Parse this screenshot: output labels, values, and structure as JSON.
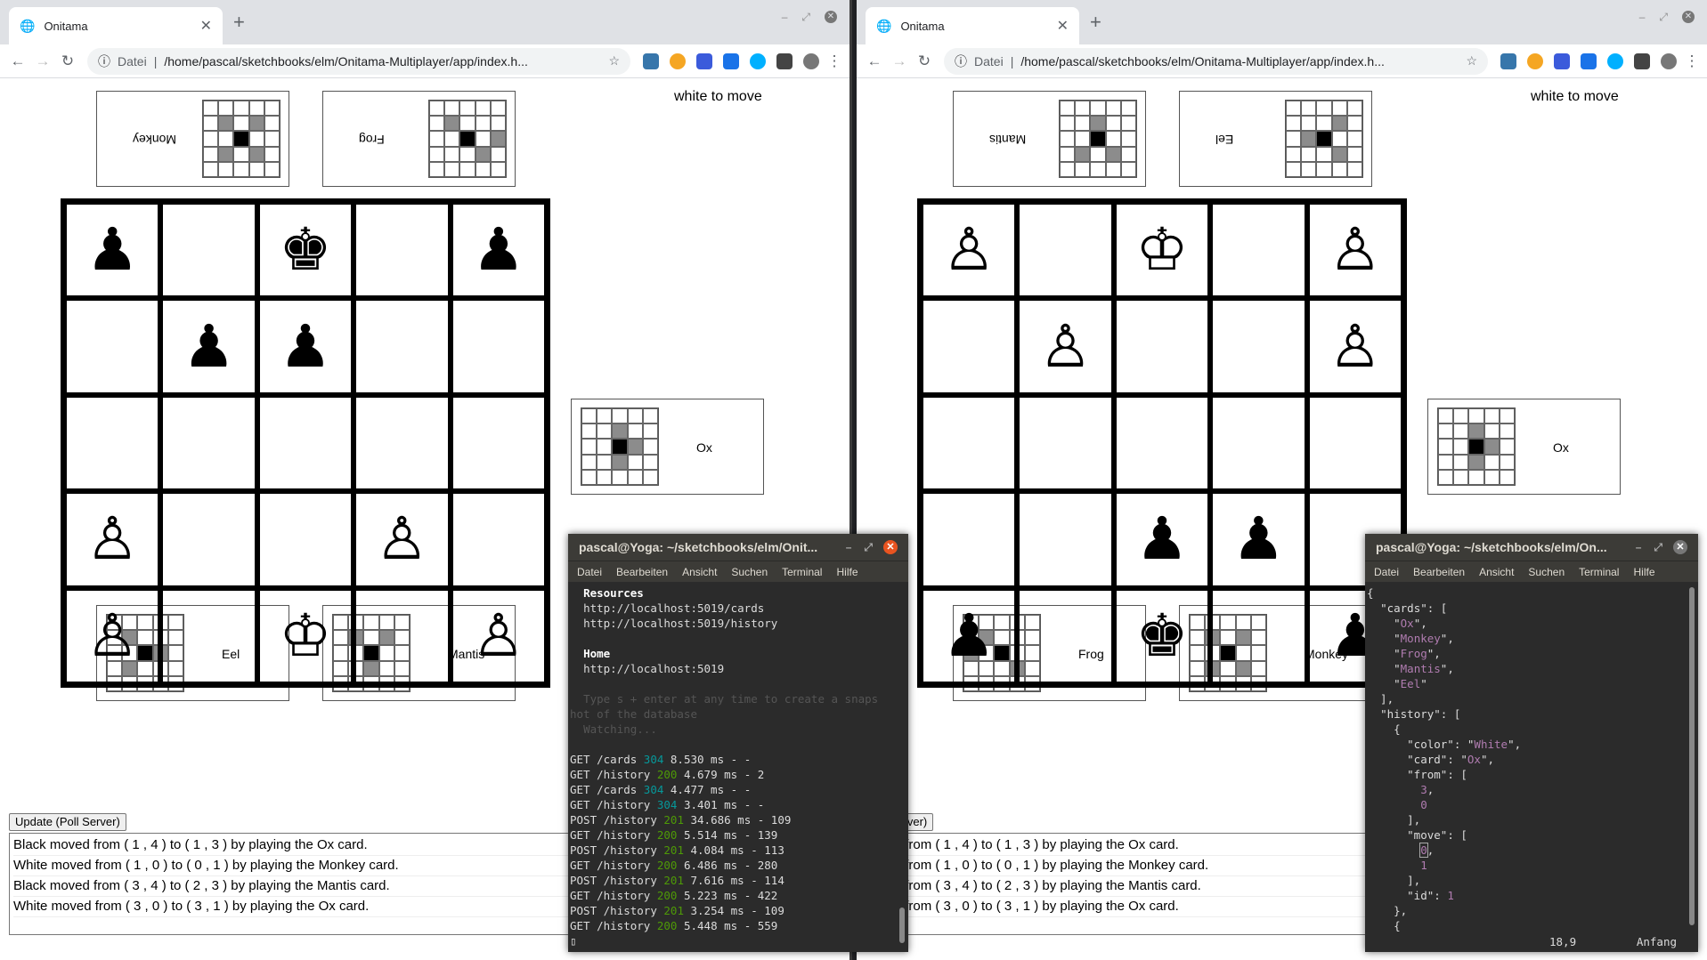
{
  "left": {
    "tab_title": "Onitama",
    "address_scheme": "Datei",
    "url": "/home/pascal/sketchbooks/elm/Onitama-Multiplayer/app/index.h...",
    "status": "white to move",
    "top_cards": [
      "Monkey",
      "Frog"
    ],
    "side_card": "Ox",
    "bottom_cards": [
      "Eel",
      "Mantis"
    ],
    "board": [
      [
        "♟",
        "",
        "♚",
        "",
        "♟"
      ],
      [
        "",
        "♟",
        "♟",
        "",
        ""
      ],
      [
        "",
        "",
        "",
        "",
        ""
      ],
      [
        "♙",
        "",
        "",
        "♙",
        ""
      ],
      [
        "♙",
        "",
        "♔",
        "",
        "♙"
      ]
    ],
    "update_button": "Update (Poll Server)",
    "log": [
      "Black moved from ( 1 , 4 ) to ( 1 , 3 ) by playing the Ox card.",
      "White moved from ( 1 , 0 ) to ( 0 , 1 ) by playing the Monkey card.",
      "Black moved from ( 3 , 4 ) to ( 2 , 3 ) by playing the Mantis card.",
      "White moved from ( 3 , 0 ) to ( 3 , 1 ) by playing the Ox card."
    ]
  },
  "right": {
    "tab_title": "Onitama",
    "address_scheme": "Datei",
    "url": "/home/pascal/sketchbooks/elm/Onitama-Multiplayer/app/index.h...",
    "status": "white to move",
    "top_cards": [
      "Mantis",
      "Eel"
    ],
    "side_card": "Ox",
    "bottom_cards": [
      "Frog",
      "Monkey"
    ],
    "board": [
      [
        "♙",
        "",
        "♔",
        "",
        "♙"
      ],
      [
        "",
        "♙",
        "",
        "",
        "♙"
      ],
      [
        "",
        "",
        "",
        "",
        ""
      ],
      [
        "",
        "",
        "♟",
        "♟",
        ""
      ],
      [
        "♟",
        "",
        "♚",
        "",
        "♟"
      ]
    ],
    "update_button": "(Poll Server)",
    "log": [
      "moved from ( 1 , 4 ) to ( 1 , 3 ) by playing the Ox card.",
      "moved from ( 1 , 0 ) to ( 0 , 1 ) by playing the Monkey card.",
      "moved from ( 3 , 4 ) to ( 2 , 3 ) by playing the Mantis card.",
      "moved from ( 3 , 0 ) to ( 3 , 1 ) by playing the Ox card."
    ]
  },
  "terminal1": {
    "title": "pascal@Yoga: ~/sketchbooks/elm/Onit...",
    "menu": [
      "Datei",
      "Bearbeiten",
      "Ansicht",
      "Suchen",
      "Terminal",
      "Hilfe"
    ],
    "resources_heading": "Resources",
    "resources": [
      "http://localhost:5019/cards",
      "http://localhost:5019/history"
    ],
    "home_heading": "Home",
    "home": "http://localhost:5019",
    "hint1": "Type s + enter at any time to create a snaps",
    "hint2": "hot of the database",
    "hint3": "Watching...",
    "requests": [
      {
        "method": "GET",
        "path": "/cards",
        "code": "304",
        "rest": "8.530 ms - -"
      },
      {
        "method": "GET",
        "path": "/history",
        "code": "200",
        "rest": "4.679 ms - 2"
      },
      {
        "method": "GET",
        "path": "/cards",
        "code": "304",
        "rest": "4.477 ms - -"
      },
      {
        "method": "GET",
        "path": "/history",
        "code": "304",
        "rest": "3.401 ms - -"
      },
      {
        "method": "POST",
        "path": "/history",
        "code": "201",
        "rest": "34.686 ms - 109"
      },
      {
        "method": "GET",
        "path": "/history",
        "code": "200",
        "rest": "5.514 ms - 139"
      },
      {
        "method": "POST",
        "path": "/history",
        "code": "201",
        "rest": "4.084 ms - 113"
      },
      {
        "method": "GET",
        "path": "/history",
        "code": "200",
        "rest": "6.486 ms - 280"
      },
      {
        "method": "POST",
        "path": "/history",
        "code": "201",
        "rest": "7.616 ms - 114"
      },
      {
        "method": "GET",
        "path": "/history",
        "code": "200",
        "rest": "5.223 ms - 422"
      },
      {
        "method": "POST",
        "path": "/history",
        "code": "201",
        "rest": "3.254 ms - 109"
      },
      {
        "method": "GET",
        "path": "/history",
        "code": "200",
        "rest": "5.448 ms - 559"
      }
    ]
  },
  "terminal2": {
    "title": "pascal@Yoga: ~/sketchbooks/elm/On...",
    "menu": [
      "Datei",
      "Bearbeiten",
      "Ansicht",
      "Suchen",
      "Terminal",
      "Hilfe"
    ],
    "cards": [
      "Ox",
      "Monkey",
      "Frog",
      "Mantis",
      "Eel"
    ],
    "color": "White",
    "card": "Ox",
    "from": [
      "3",
      "0"
    ],
    "move": [
      "0",
      "1"
    ],
    "id": "1",
    "cursor_pos": "18,9",
    "position_label": "Anfang"
  },
  "card_patterns": {
    "Monkey": {
      "moves": [
        [
          1,
          1
        ],
        [
          3,
          1
        ],
        [
          1,
          3
        ],
        [
          3,
          3
        ]
      ]
    },
    "Frog": {
      "moves": [
        [
          1,
          1
        ],
        [
          0,
          2
        ],
        [
          3,
          3
        ]
      ]
    },
    "Ox": {
      "moves": [
        [
          2,
          1
        ],
        [
          3,
          2
        ],
        [
          2,
          3
        ]
      ]
    },
    "Eel": {
      "moves": [
        [
          1,
          1
        ],
        [
          3,
          2
        ],
        [
          1,
          3
        ]
      ]
    },
    "Mantis": {
      "moves": [
        [
          1,
          1
        ],
        [
          3,
          1
        ],
        [
          2,
          3
        ]
      ]
    }
  }
}
